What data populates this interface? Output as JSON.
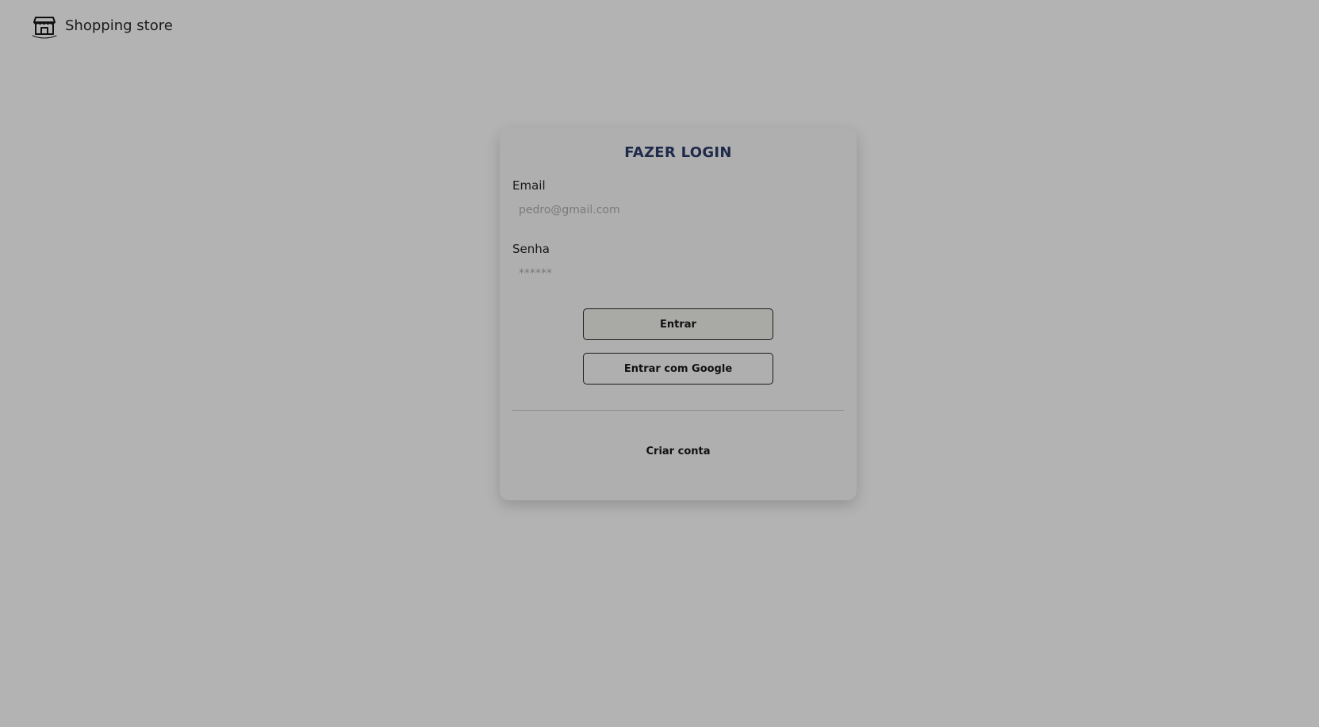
{
  "header": {
    "brand_name": "Shopping store",
    "logo_icon": "storefront-icon"
  },
  "login": {
    "title": "FAZER LOGIN",
    "email_label": "Email",
    "email_placeholder": "pedro@gmail.com",
    "password_label": "Senha",
    "password_placeholder": "******",
    "submit_label": "Entrar",
    "google_label": "Entrar com Google",
    "create_account_label": "Criar conta"
  },
  "colors": {
    "background": "#b3b3b3",
    "card": "#afafaf",
    "title": "#1f2a4b",
    "primary_button": "#a9a9a6"
  }
}
